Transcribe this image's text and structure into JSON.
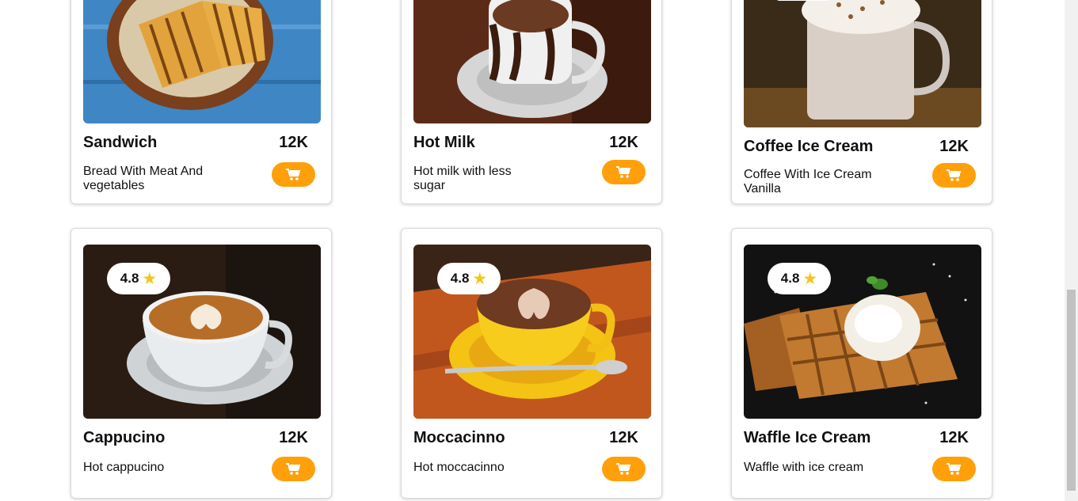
{
  "colors": {
    "accent": "#ff9f0a",
    "star": "#f5c518"
  },
  "products": [
    {
      "name": "Sandwich",
      "price": "12K",
      "desc": "Bread With Meat And vegetables",
      "rating": "",
      "image_icon": "sandwich-image"
    },
    {
      "name": "Hot Milk",
      "price": "12K",
      "desc": "Hot milk with less sugar",
      "rating": "",
      "image_icon": "hot-milk-image"
    },
    {
      "name": "Coffee Ice Cream",
      "price": "12K",
      "desc": "Coffee With Ice Cream Vanilla",
      "rating": "",
      "image_icon": "coffee-ice-cream-image"
    },
    {
      "name": "Cappucino",
      "price": "12K",
      "desc": "Hot cappucino",
      "rating": "4.8",
      "image_icon": "cappucino-image"
    },
    {
      "name": "Moccacinno",
      "price": "12K",
      "desc": "Hot moccacinno",
      "rating": "4.8",
      "image_icon": "moccacinno-image"
    },
    {
      "name": "Waffle Ice Cream",
      "price": "12K",
      "desc": "Waffle with ice cream",
      "rating": "4.8",
      "image_icon": "waffle-ice-cream-image"
    }
  ],
  "cart_icon": "shopping-cart-icon",
  "star_icon": "star-icon"
}
